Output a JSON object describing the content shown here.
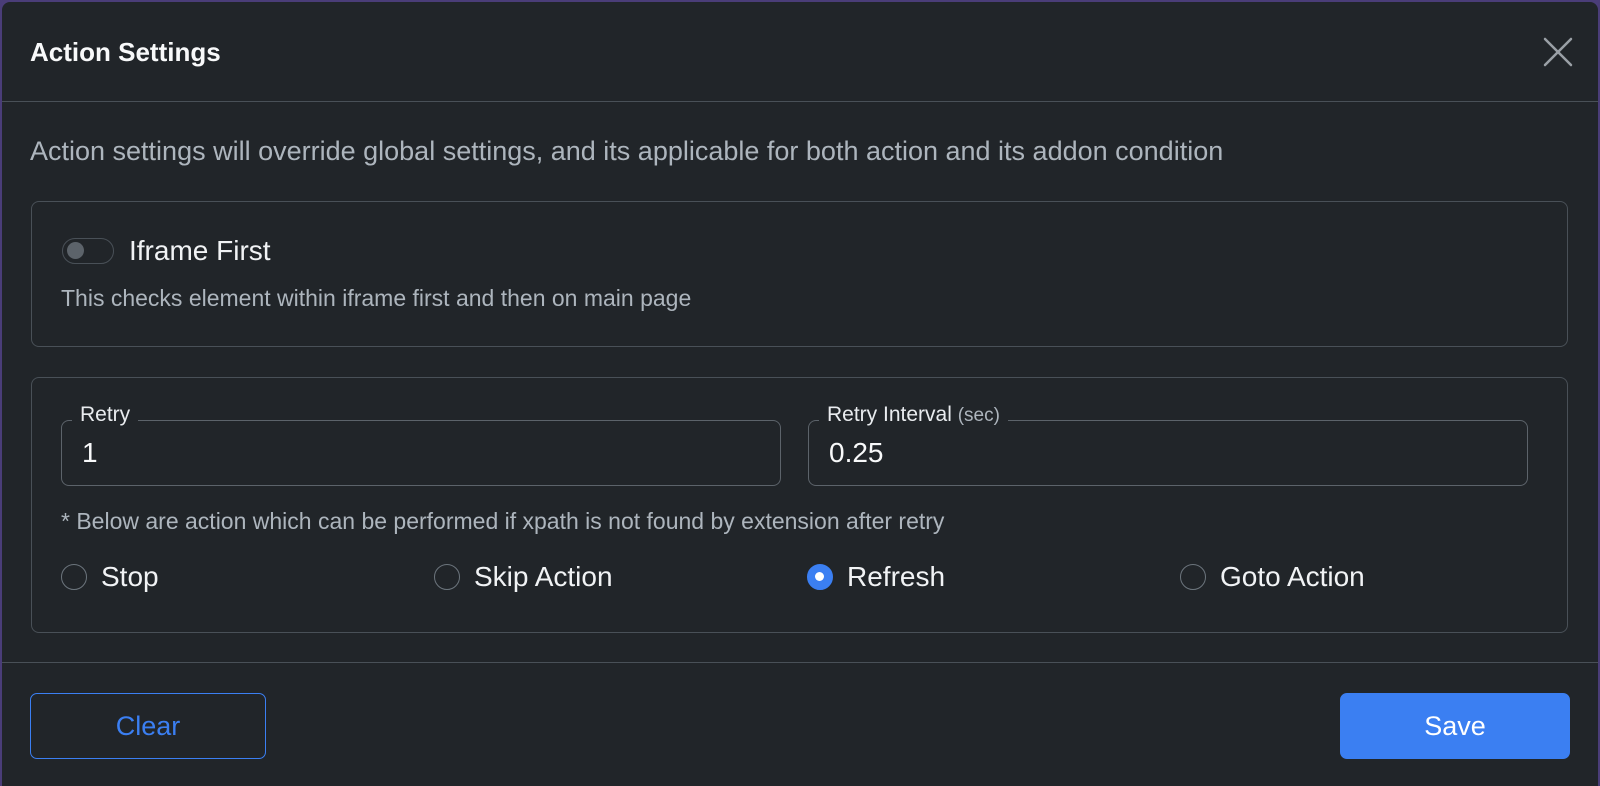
{
  "modal": {
    "title": "Action Settings",
    "description": "Action settings will override global settings, and its applicable for both action and its addon condition"
  },
  "iframe_first": {
    "label": "Iframe First",
    "help": "This checks element within iframe first and then on main page",
    "enabled": false
  },
  "retry": {
    "label": "Retry",
    "value": "1"
  },
  "retry_interval": {
    "label": "Retry Interval",
    "unit": "(sec)",
    "value": "0.25"
  },
  "fallback": {
    "note": "* Below are action which can be performed if xpath is not found by extension after retry",
    "options": [
      {
        "label": "Stop",
        "checked": false
      },
      {
        "label": "Skip Action",
        "checked": false
      },
      {
        "label": "Refresh",
        "checked": true
      },
      {
        "label": "Goto Action",
        "checked": false
      }
    ]
  },
  "footer": {
    "clear_label": "Clear",
    "save_label": "Save"
  },
  "colors": {
    "background": "#212529",
    "accent": "#3b7ff2",
    "border": "#495057"
  },
  "icons": {
    "close": "close-icon"
  }
}
